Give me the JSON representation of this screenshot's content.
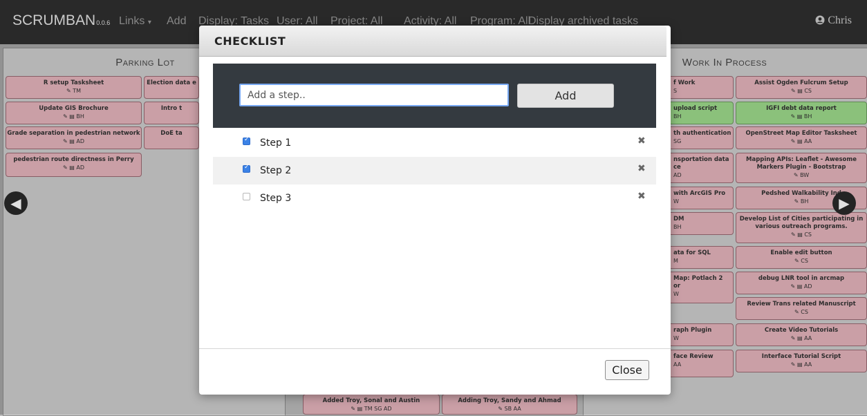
{
  "navbar": {
    "brand": "SCRUMBAN",
    "version": "0.0.6",
    "links": [
      "Links",
      "Add",
      "Display: Tasks",
      "User: All",
      "Project: All",
      "Activity: All",
      "Program: All",
      "Display archived tasks"
    ],
    "links_caret": "▾",
    "user": "Chris",
    "user_icon": "user-circle-icon"
  },
  "parking_lot": {
    "title": "Parking Lot",
    "cards": [
      {
        "title": "R setup Tasksheet",
        "meta": "TM"
      },
      {
        "title": "Election data e",
        "meta": ""
      },
      {
        "title": "Update GIS Brochure",
        "meta": "BH"
      },
      {
        "title": "Intro t",
        "meta": ""
      },
      {
        "title": "Grade separation in pedestrian network",
        "meta": "AD"
      },
      {
        "title": "DoE ta",
        "meta": ""
      },
      {
        "title": "pedestrian route directness in Perry",
        "meta": "AD"
      }
    ]
  },
  "work_in_process": {
    "title": "Work In Process",
    "left_cards": [
      {
        "title": "f Work",
        "meta": "S"
      },
      {
        "title": "upload script",
        "meta": "BH"
      },
      {
        "title": "th authentication",
        "meta": "SG"
      },
      {
        "title": "nsportation data",
        "line2": "ce",
        "meta": "AD"
      },
      {
        "title": "with ArcGIS Pro",
        "meta": "W"
      },
      {
        "title": "DM",
        "meta": "BH"
      },
      {
        "title": "ata for SQL",
        "meta": "M"
      },
      {
        "title": "Map: Potlach 2",
        "line2": "or",
        "meta": "W"
      },
      {
        "title": "raph Plugin",
        "meta": "W"
      },
      {
        "title": "face Review",
        "meta": "AA"
      }
    ],
    "right_cards": [
      {
        "title": "Assist Ogden Fulcrum Setup",
        "meta": "CS"
      },
      {
        "title": "IGFI debt data report",
        "meta": "BH"
      },
      {
        "title": "OpenStreet Map Editor Tasksheet",
        "meta": "AA"
      },
      {
        "title": "Mapping APIs: Leaflet - Awesome Markers Plugin - Bootstrap",
        "meta": "BW"
      },
      {
        "title": "Pedshed Walkability Ind",
        "meta": "BH"
      },
      {
        "title": "Develop List of Cities participating in various outreach programs.",
        "meta": "CS"
      },
      {
        "title": "Enable edit button",
        "meta": "CS"
      },
      {
        "title": "debug LNR tool in arcmap",
        "meta": "AD"
      },
      {
        "title": "Review Trans related Manuscript",
        "meta": "CS"
      },
      {
        "title": "Create Video Tutorials",
        "meta": "AA"
      },
      {
        "title": "Interface Tutorial Script",
        "meta": "AA"
      }
    ]
  },
  "bottom_cards": [
    {
      "title": "Added Troy, Sonal and Austin",
      "meta": "TM SG AD"
    },
    {
      "title": "Adding Troy, Sandy and Ahmad",
      "meta": "SB AA"
    }
  ],
  "nav_arrows": {
    "left_icon": "arrow-left-circle-icon",
    "right_icon": "arrow-right-circle-icon",
    "left_glyph": "◀",
    "right_glyph": "▶"
  },
  "modal": {
    "title": "CHECKLIST",
    "input": {
      "placeholder": "Add a step..",
      "value": ""
    },
    "add_label": "Add",
    "steps": [
      {
        "label": "Step 1",
        "checked": true
      },
      {
        "label": "Step 2",
        "checked": true
      },
      {
        "label": "Step 3",
        "checked": false
      }
    ],
    "delete_glyph": "✖",
    "close_label": "Close"
  },
  "colors": {
    "card_pink": "#e6b5bd",
    "card_green": "#9fdc8c",
    "navbar_bg": "#2f2f2f",
    "checkbox_blue": "#3b82e6",
    "input_focus": "#77a8f2"
  }
}
